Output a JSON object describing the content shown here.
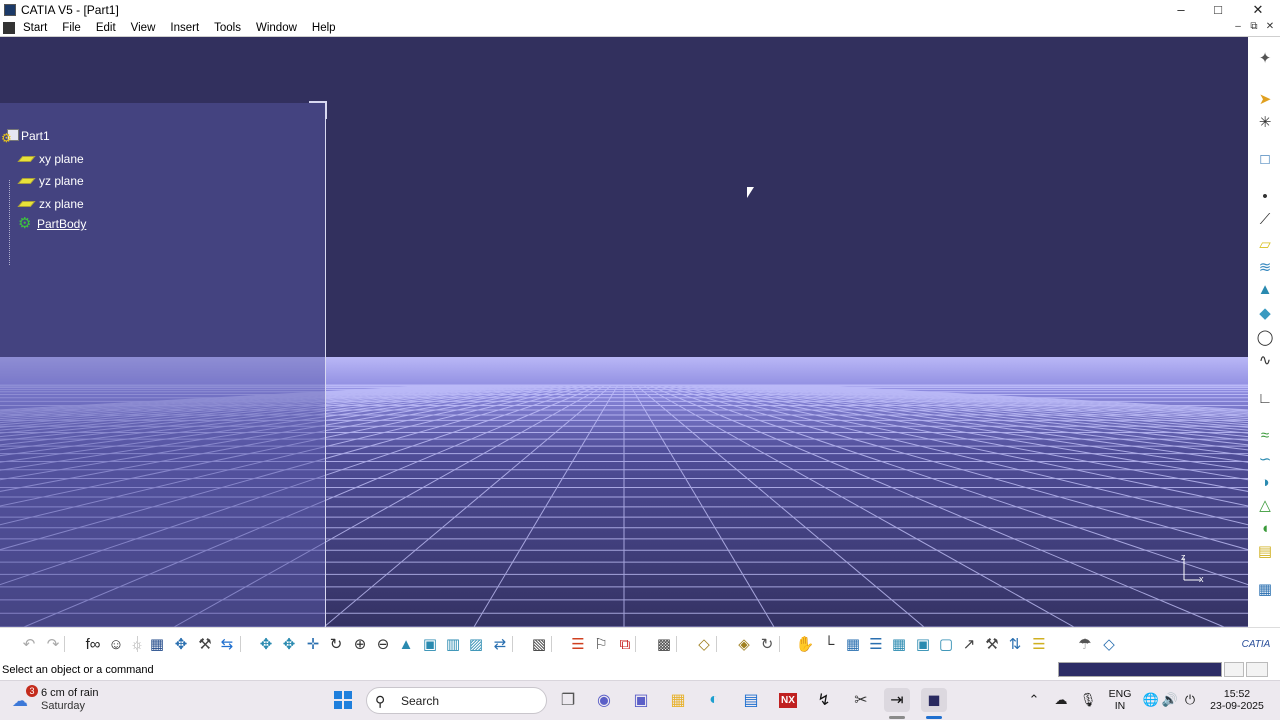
{
  "window": {
    "title": "CATIA V5 - [Part1]",
    "controls": {
      "minimize": "–",
      "maximize": "□",
      "close": "✕"
    },
    "mdi_controls": {
      "minimize": "–",
      "restore": "⧉",
      "close": "✕"
    }
  },
  "menubar": {
    "items": [
      "Start",
      "File",
      "Edit",
      "View",
      "Insert",
      "Tools",
      "Window",
      "Help"
    ]
  },
  "spec_tree": {
    "root": "Part1",
    "children": [
      "xy plane",
      "yz plane",
      "zx plane",
      "PartBody"
    ]
  },
  "viewport": {
    "background_color": "#32305e",
    "ground_color": "#b5b3f2",
    "axis_labels": {
      "z": "z",
      "x": "x"
    }
  },
  "right_toolbar": {
    "icons": [
      "compass-icon",
      "select-icon",
      "sketcher-icon",
      "sketch-plane-icon",
      "point-icon",
      "line-icon",
      "plane-icon",
      "projection-icon",
      "extrude-icon",
      "intersection-icon",
      "circle-icon",
      "spline-icon",
      "corner-icon",
      "fill-icon",
      "sweep-icon",
      "offset-icon",
      "multi-section-icon",
      "loft-icon",
      "blend-icon",
      "catalog-icon"
    ]
  },
  "bottom_toolbar": {
    "icons": [
      "undo-icon",
      "redo-icon",
      "formula-icon",
      "knowledge-icon",
      "light-icon",
      "table-icon",
      "tree-icon",
      "bom-icon",
      "measure-icon",
      "pan-icon",
      "fit-all-icon",
      "move-icon",
      "rotate-icon",
      "zoom-in-icon",
      "zoom-out-icon",
      "normal-view-icon",
      "isometric-icon",
      "render-style-icon",
      "hide-show-icon",
      "swap-icon",
      "layer-icon",
      "properties-icon",
      "constraint-icon",
      "snapshot-icon",
      "analysis-icon",
      "material-icon",
      "apply-material-icon",
      "update-icon",
      "explode-icon",
      "axis-system-icon",
      "grid-icon",
      "fly-icon",
      "mesh-icon",
      "section-icon",
      "compass-reset-icon",
      "dimension-icon",
      "sketch-tools-icon",
      "scan-icon",
      "catalog-browser-icon",
      "dimension-parameters-icon",
      "geometry-icon"
    ],
    "catia_logo": "CATIA"
  },
  "statusbar": {
    "message": "Select an object or a command"
  },
  "taskbar": {
    "weather": {
      "badge": "3",
      "temp": "6 cm of rain",
      "day": "Saturday"
    },
    "search_placeholder": "Search",
    "apps": [
      "start-icon",
      "task-view-icon",
      "chat-icon",
      "teams-icon",
      "file-explorer-icon",
      "edge-icon",
      "store-icon",
      "nx-icon",
      "solidworks-icon",
      "snipping-tool-icon",
      "terminal-icon",
      "catia-icon"
    ],
    "nx_label": "NX",
    "tray": {
      "lang_line1": "ENG",
      "lang_line2": "IN",
      "time": "15:52",
      "date": "23-09-2025"
    }
  }
}
